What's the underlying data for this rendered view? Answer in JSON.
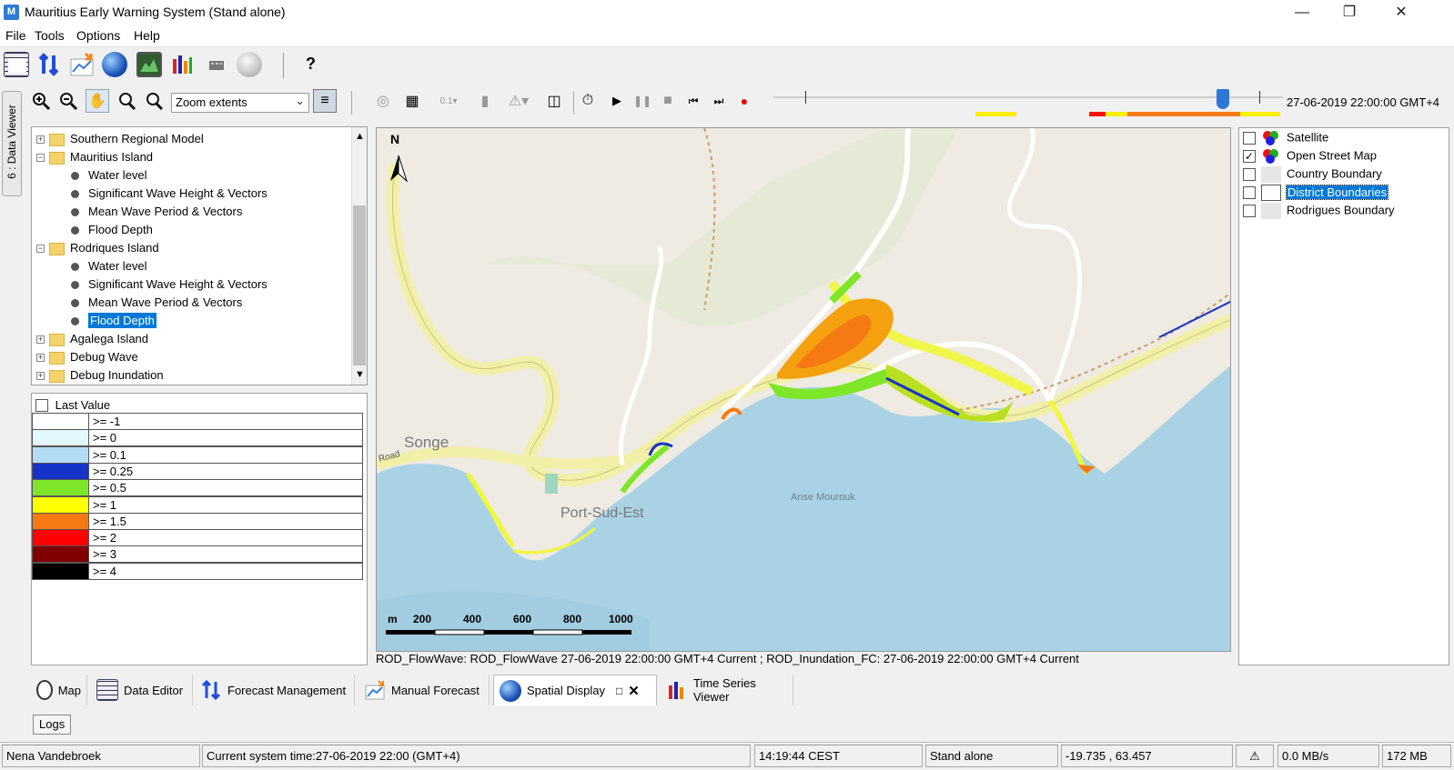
{
  "window": {
    "title": "Mauritius Early Warning System  (Stand alone)",
    "app_icon": "mews-app-icon"
  },
  "menu": [
    "File",
    "Tools",
    "Options",
    "Help"
  ],
  "toolbar_main": {
    "help_label": "?",
    "icons": [
      "data-editor-icon",
      "forecast-management-icon",
      "manual-forecast-icon",
      "spatial-display-icon",
      "map-view-icon",
      "time-series-icon",
      "database-icon",
      "wiki-icon"
    ]
  },
  "side_tab": {
    "label": "6 : Data Viewer"
  },
  "map_toolbar": {
    "zoom_select": "Zoom extents",
    "time_label": "27-06-2019 22:00:00 GMT+4",
    "steps_label": "0.1"
  },
  "tree": {
    "items": [
      {
        "label": "Southern Regional Model",
        "kind": "folder",
        "level": 0,
        "expander": "+"
      },
      {
        "label": "Mauritius Island",
        "kind": "folder",
        "level": 0,
        "expander": "−"
      },
      {
        "label": "Water level",
        "kind": "leaf",
        "level": 1
      },
      {
        "label": "Significant Wave Height & Vectors",
        "kind": "leaf",
        "level": 1
      },
      {
        "label": "Mean Wave Period & Vectors",
        "kind": "leaf",
        "level": 1
      },
      {
        "label": "Flood Depth",
        "kind": "leaf",
        "level": 1
      },
      {
        "label": "Rodriques Island",
        "kind": "folder",
        "level": 0,
        "expander": "−"
      },
      {
        "label": "Water level",
        "kind": "leaf",
        "level": 1
      },
      {
        "label": "Significant Wave Height & Vectors",
        "kind": "leaf",
        "level": 1
      },
      {
        "label": "Mean Wave Period & Vectors",
        "kind": "leaf",
        "level": 1
      },
      {
        "label": "Flood Depth",
        "kind": "leaf",
        "level": 1,
        "selected": true
      },
      {
        "label": "Agalega Island",
        "kind": "folder",
        "level": 0,
        "expander": "+"
      },
      {
        "label": "Debug Wave",
        "kind": "folder",
        "level": 0,
        "expander": "+"
      },
      {
        "label": "Debug Inundation",
        "kind": "folder",
        "level": 0,
        "expander": "+"
      }
    ]
  },
  "legend": {
    "checkbox_label": "Last Value",
    "rows": [
      {
        "label": ">= -1",
        "color": "#ffffff"
      },
      {
        "label": ">= 0",
        "color": "#e2f8fc"
      },
      {
        "label": ">= 0.1",
        "color": "#b3dcf5"
      },
      {
        "label": ">= 0.25",
        "color": "#1532c9"
      },
      {
        "label": ">= 0.5",
        "color": "#7ee628"
      },
      {
        "label": ">= 1",
        "color": "#ffff00"
      },
      {
        "label": ">= 1.5",
        "color": "#f57a14"
      },
      {
        "label": ">= 2",
        "color": "#ff0000"
      },
      {
        "label": ">= 3",
        "color": "#800000"
      },
      {
        "label": ">= 4",
        "color": "#000000"
      }
    ]
  },
  "map": {
    "north_label": "N",
    "place_labels": {
      "songe": "Songe",
      "port": "Port-Sud-Est",
      "anse": "Anse Mourouk",
      "road": "Road"
    },
    "scale": {
      "unit": "m",
      "ticks": [
        "200",
        "400",
        "600",
        "800",
        "1000"
      ]
    },
    "status": "ROD_FlowWave: ROD_FlowWave 27-06-2019 22:00:00 GMT+4 Current ; ROD_Inundation_FC: 27-06-2019 22:00:00 GMT+4 Current"
  },
  "layers": [
    {
      "label": "Satellite",
      "checked": false,
      "icon": "rgb-icon"
    },
    {
      "label": "Open Street Map",
      "checked": true,
      "icon": "rgb-icon"
    },
    {
      "label": "Country Boundary",
      "checked": false,
      "icon": "none"
    },
    {
      "label": "District Boundaries",
      "checked": false,
      "icon": "none",
      "selected": true
    },
    {
      "label": "Rodrigues Boundary",
      "checked": false,
      "icon": "none"
    }
  ],
  "bottom_tabs": [
    {
      "label": "Map",
      "icon": "globe-icon"
    },
    {
      "label": "Data Editor",
      "icon": "data-editor-icon"
    },
    {
      "label": "Forecast Management",
      "icon": "forecast-management-icon"
    },
    {
      "label": "Manual Forecast",
      "icon": "manual-forecast-icon"
    },
    {
      "label": "Spatial Display",
      "icon": "spatial-display-icon",
      "active": true
    },
    {
      "label": "Time Series Viewer",
      "icon": "time-series-icon"
    }
  ],
  "logs_label": "Logs",
  "status_bar": {
    "user": "Nena Vandebroek",
    "system_time": "Current system time:27-06-2019 22:00 (GMT+4)",
    "clock": "14:19:44 CEST",
    "mode": "Stand alone",
    "coords": "-19.735 , 63.457",
    "rate": "0.0 MB/s",
    "memory": "172 MB"
  },
  "colors": {
    "accent": "#0078d7",
    "selection": "#0078d7",
    "water": "#a9d3e5",
    "land": "#efeae2",
    "road": "#f7f7b8"
  }
}
